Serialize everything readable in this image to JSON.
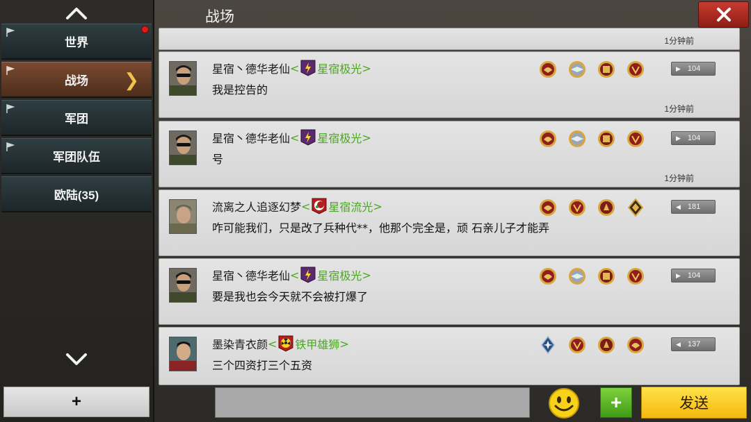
{
  "sidebar": {
    "tabs": [
      {
        "label": "世界",
        "pinned": true,
        "notification": true,
        "active": false
      },
      {
        "label": "战场",
        "pinned": true,
        "notification": false,
        "active": true
      },
      {
        "label": "军团",
        "pinned": true,
        "notification": false,
        "active": false
      },
      {
        "label": "军团队伍",
        "pinned": true,
        "notification": false,
        "active": false
      },
      {
        "label": "欧陆(35)",
        "pinned": false,
        "notification": false,
        "active": false
      }
    ],
    "add_label": "+"
  },
  "header": {
    "title": "战场"
  },
  "messages": {
    "partial_time": "1分钟前",
    "items": [
      {
        "sender": "星宿丶德华老仙",
        "guild": "星宿极光",
        "guild_icon": "lightning-icon",
        "text": "我是控告的",
        "time": "1分钟前",
        "rank": "104",
        "medals": [
          "red-eagle-medal",
          "silver-wings-medal",
          "gold-crest-medal",
          "laurel-medal"
        ]
      },
      {
        "sender": "星宿丶德华老仙",
        "guild": "星宿极光",
        "guild_icon": "lightning-icon",
        "text": "号",
        "time": "1分钟前",
        "rank": "104",
        "medals": [
          "red-eagle-medal",
          "silver-wings-medal",
          "gold-crest-medal",
          "laurel-medal"
        ]
      },
      {
        "sender": "流离之人追逐幻梦",
        "guild": "星宿流光",
        "guild_icon": "crescent-icon",
        "text": "咋可能我们，只是改了兵种代**，他那个完全是，顽 石亲儿子才能弄",
        "time": "",
        "rank": "181",
        "medals": [
          "red-eagle-medal",
          "red-laurel-medal",
          "red-crest-medal",
          "diamond-rank-medal"
        ]
      },
      {
        "sender": "星宿丶德华老仙",
        "guild": "星宿极光",
        "guild_icon": "lightning-icon",
        "text": "要是我也会今天就不会被打爆了",
        "time": "",
        "rank": "104",
        "medals": [
          "red-eagle-medal",
          "silver-wings-medal",
          "gold-crest-medal",
          "laurel-medal"
        ]
      },
      {
        "sender": "墨染青衣颜",
        "guild": "铁甲雄狮",
        "guild_icon": "radiation-icon",
        "text": "三个四资打三个五资",
        "time": "",
        "rank": "137",
        "medals": [
          "blue-star-medal",
          "red-laurel-medal",
          "red-crest-medal",
          "red-eagle-medal"
        ]
      }
    ]
  },
  "composer": {
    "value": "",
    "send_label": "发送",
    "plus_label": "+"
  },
  "colors": {
    "guild_green": "#4da524",
    "active_tab": "#6b3f28",
    "send_yellow": "#f7c51a",
    "close_red": "#b52d23"
  }
}
